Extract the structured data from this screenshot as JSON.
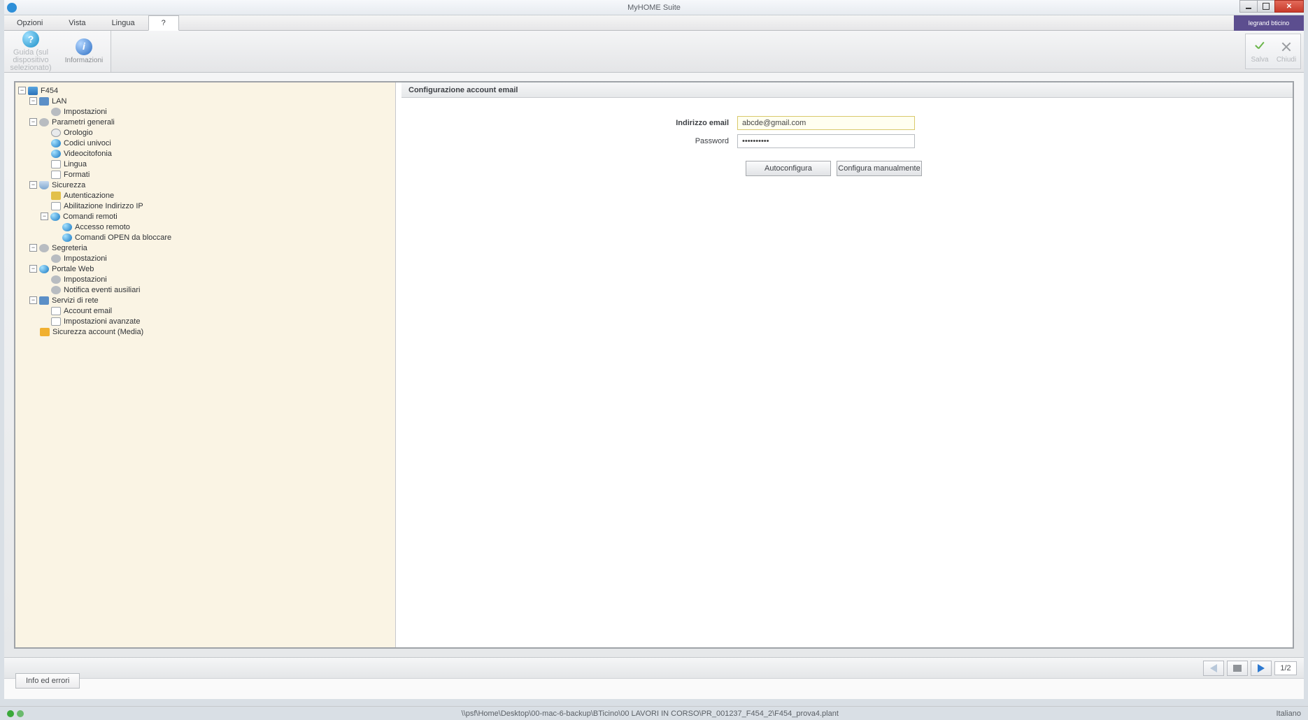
{
  "window": {
    "title": "MyHOME Suite"
  },
  "menu": {
    "items": [
      "Opzioni",
      "Vista",
      "Lingua",
      "?"
    ],
    "active_index": 3,
    "brand": "legrand bticino"
  },
  "ribbon": {
    "help": {
      "label_line1": "Guida (sul",
      "label_line2": "dispositivo selezionato)"
    },
    "info": {
      "label": "Informazioni"
    },
    "save": {
      "label": "Salva"
    },
    "close": {
      "label": "Chiudi"
    }
  },
  "tree": [
    {
      "ind": 0,
      "exp": "minus",
      "icon": "device",
      "label": "F454"
    },
    {
      "ind": 1,
      "exp": "minus",
      "icon": "monitor",
      "label": "LAN"
    },
    {
      "ind": 2,
      "exp": "",
      "icon": "gear",
      "label": "Impostazioni"
    },
    {
      "ind": 1,
      "exp": "minus",
      "icon": "gear",
      "label": "Parametri generali"
    },
    {
      "ind": 2,
      "exp": "",
      "icon": "clock",
      "label": "Orologio"
    },
    {
      "ind": 2,
      "exp": "",
      "icon": "globe",
      "label": "Codici univoci"
    },
    {
      "ind": 2,
      "exp": "",
      "icon": "globe",
      "label": "Videocitofonia"
    },
    {
      "ind": 2,
      "exp": "",
      "icon": "page",
      "label": "Lingua"
    },
    {
      "ind": 2,
      "exp": "",
      "icon": "page",
      "label": "Formati"
    },
    {
      "ind": 1,
      "exp": "minus",
      "icon": "shield",
      "label": "Sicurezza"
    },
    {
      "ind": 2,
      "exp": "",
      "icon": "key",
      "label": "Autenticazione"
    },
    {
      "ind": 2,
      "exp": "",
      "icon": "page",
      "label": "Abilitazione Indirizzo IP"
    },
    {
      "ind": 2,
      "exp": "minus",
      "icon": "globe",
      "label": "Comandi remoti"
    },
    {
      "ind": 3,
      "exp": "",
      "icon": "globe",
      "label": "Accesso remoto"
    },
    {
      "ind": 3,
      "exp": "",
      "icon": "globe",
      "label": "Comandi OPEN da bloccare"
    },
    {
      "ind": 1,
      "exp": "minus",
      "icon": "gear",
      "label": "Segreteria"
    },
    {
      "ind": 2,
      "exp": "",
      "icon": "gear",
      "label": "Impostazioni"
    },
    {
      "ind": 1,
      "exp": "minus",
      "icon": "globe",
      "label": "Portale Web"
    },
    {
      "ind": 2,
      "exp": "",
      "icon": "gear",
      "label": "Impostazioni"
    },
    {
      "ind": 2,
      "exp": "",
      "icon": "gear",
      "label": "Notifica eventi ausiliari"
    },
    {
      "ind": 1,
      "exp": "minus",
      "icon": "monitor",
      "label": "Servizi di rete"
    },
    {
      "ind": 2,
      "exp": "",
      "icon": "page",
      "label": "Account email"
    },
    {
      "ind": 2,
      "exp": "",
      "icon": "page",
      "label": "Impostazioni avanzate"
    },
    {
      "ind": 1,
      "exp": "",
      "icon": "lock",
      "label": "Sicurezza account (Media)"
    }
  ],
  "form": {
    "header": "Configurazione account email",
    "email_label": "Indirizzo email",
    "email_value": "abcde@gmail.com",
    "password_label": "Password",
    "password_value": "••••••••••",
    "btn_auto": "Autoconfigura",
    "btn_manual": "Configura manualmente"
  },
  "footer": {
    "page_indicator": "1/2",
    "tab": "Info ed errori",
    "path": "\\\\psf\\Home\\Desktop\\00-mac-6-backup\\BTicino\\00 LAVORI IN CORSO\\PR_001237_F454_2\\F454_prova4.plant",
    "language": "Italiano"
  }
}
